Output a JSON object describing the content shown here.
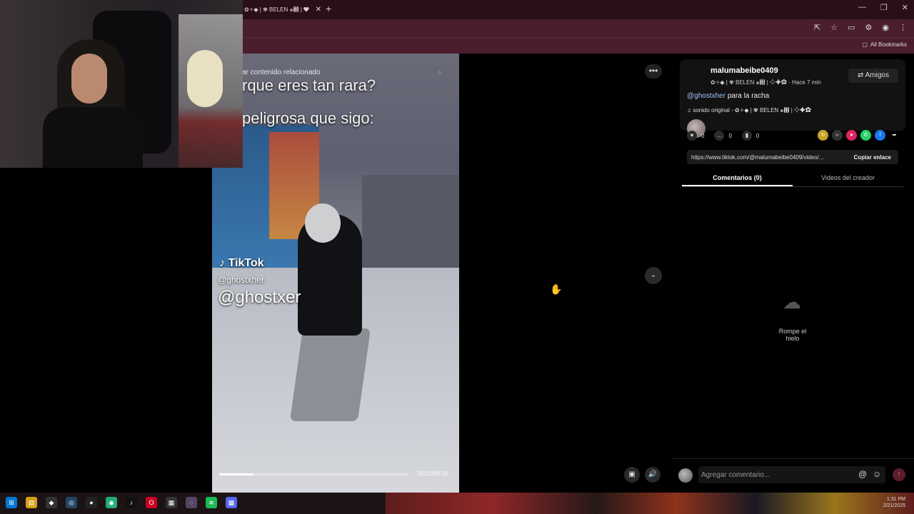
{
  "browser": {
    "tab_title": "✿✧◆ | ✾ BELEN ๑฻ | ❤",
    "tab_close": "✕",
    "new_tab": "+",
    "window_controls": [
      "—",
      "❐",
      "✕"
    ],
    "bookmarks_label": "All Bookmarks"
  },
  "video": {
    "search_text": "ar contenido relacionado",
    "overlay_line1": "rque eres tan rara?",
    "overlay_line2": "peligrosa que sigo:",
    "watermark_logo": "TikTok",
    "watermark_user": "@ghostxher",
    "watermark_big": "@ghostxer",
    "time": "00:01/00:10",
    "progress": 0.18
  },
  "post": {
    "username": "malumabeibe0409",
    "subline": "✿✧◆ | ✾ BELEN ๑฻ | ✧✦✿ · Hace 7 min",
    "friends_button": "Amigos",
    "caption_mention": "@ghostxher",
    "caption_text": " para la racha",
    "music": "sonido original - ✿✧◆ | ✾ BELEN ๑฻ | ✧✦✿",
    "likes": "0",
    "comments": "0",
    "saves": "0",
    "url": "https://www.tiktok.com/@malumabeibe0409/video/...",
    "copy_button": "Copiar enlace",
    "tab_comments": "Comentarios (0)",
    "tab_creator": "Videos del creador",
    "empty_text": "Rompe el hielo",
    "comment_placeholder": "Agregar comentario..."
  },
  "colors": {
    "accent_send": "#5a1e2a",
    "mention": "#9fc4ff",
    "chrome_bar": "#4a1e2c"
  },
  "taskbar": {
    "clock_time": "1:31 PM",
    "clock_date": "2/21/2025"
  }
}
